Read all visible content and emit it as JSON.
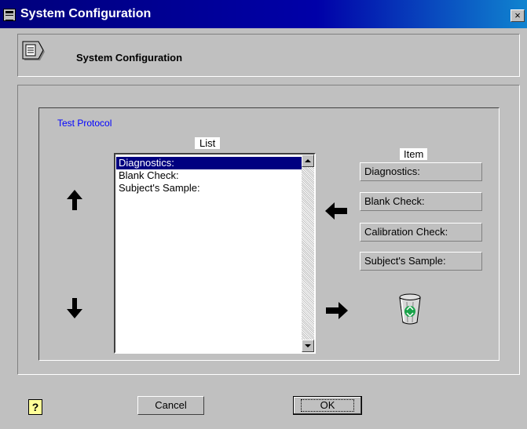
{
  "window": {
    "title": "System Configuration",
    "close_label": "×"
  },
  "header": {
    "title": "System Configuration"
  },
  "group": {
    "label": "Test Protocol"
  },
  "list": {
    "label": "List",
    "items": [
      "Diagnostics:",
      "Blank Check:",
      "Subject's Sample:"
    ],
    "selected_index": 0
  },
  "item": {
    "label": "Item",
    "buttons": [
      "Diagnostics:",
      "Blank Check:",
      "Calibration Check:",
      "Subject's Sample:"
    ]
  },
  "icons": {
    "move_up": "arrow-up-icon",
    "move_down": "arrow-down-icon",
    "add_to_list": "arrow-left-icon",
    "remove_from_list": "arrow-right-icon",
    "trash": "recycle-bin-icon",
    "help": "?"
  },
  "footer": {
    "cancel_label": "Cancel",
    "ok_label": "OK"
  },
  "colors": {
    "title_bar": "#000080",
    "selection": "#000080",
    "group_label": "#0000ff",
    "help_bg": "#ffff99"
  }
}
